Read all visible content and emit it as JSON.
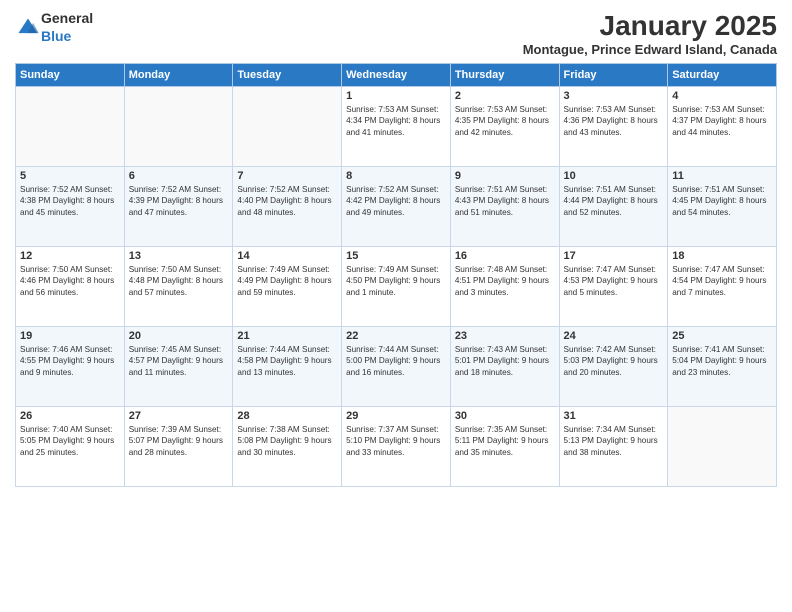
{
  "logo": {
    "general": "General",
    "blue": "Blue"
  },
  "title": "January 2025",
  "location": "Montague, Prince Edward Island, Canada",
  "days_of_week": [
    "Sunday",
    "Monday",
    "Tuesday",
    "Wednesday",
    "Thursday",
    "Friday",
    "Saturday"
  ],
  "weeks": [
    [
      {
        "day": "",
        "info": ""
      },
      {
        "day": "",
        "info": ""
      },
      {
        "day": "",
        "info": ""
      },
      {
        "day": "1",
        "info": "Sunrise: 7:53 AM\nSunset: 4:34 PM\nDaylight: 8 hours\nand 41 minutes."
      },
      {
        "day": "2",
        "info": "Sunrise: 7:53 AM\nSunset: 4:35 PM\nDaylight: 8 hours\nand 42 minutes."
      },
      {
        "day": "3",
        "info": "Sunrise: 7:53 AM\nSunset: 4:36 PM\nDaylight: 8 hours\nand 43 minutes."
      },
      {
        "day": "4",
        "info": "Sunrise: 7:53 AM\nSunset: 4:37 PM\nDaylight: 8 hours\nand 44 minutes."
      }
    ],
    [
      {
        "day": "5",
        "info": "Sunrise: 7:52 AM\nSunset: 4:38 PM\nDaylight: 8 hours\nand 45 minutes."
      },
      {
        "day": "6",
        "info": "Sunrise: 7:52 AM\nSunset: 4:39 PM\nDaylight: 8 hours\nand 47 minutes."
      },
      {
        "day": "7",
        "info": "Sunrise: 7:52 AM\nSunset: 4:40 PM\nDaylight: 8 hours\nand 48 minutes."
      },
      {
        "day": "8",
        "info": "Sunrise: 7:52 AM\nSunset: 4:42 PM\nDaylight: 8 hours\nand 49 minutes."
      },
      {
        "day": "9",
        "info": "Sunrise: 7:51 AM\nSunset: 4:43 PM\nDaylight: 8 hours\nand 51 minutes."
      },
      {
        "day": "10",
        "info": "Sunrise: 7:51 AM\nSunset: 4:44 PM\nDaylight: 8 hours\nand 52 minutes."
      },
      {
        "day": "11",
        "info": "Sunrise: 7:51 AM\nSunset: 4:45 PM\nDaylight: 8 hours\nand 54 minutes."
      }
    ],
    [
      {
        "day": "12",
        "info": "Sunrise: 7:50 AM\nSunset: 4:46 PM\nDaylight: 8 hours\nand 56 minutes."
      },
      {
        "day": "13",
        "info": "Sunrise: 7:50 AM\nSunset: 4:48 PM\nDaylight: 8 hours\nand 57 minutes."
      },
      {
        "day": "14",
        "info": "Sunrise: 7:49 AM\nSunset: 4:49 PM\nDaylight: 8 hours\nand 59 minutes."
      },
      {
        "day": "15",
        "info": "Sunrise: 7:49 AM\nSunset: 4:50 PM\nDaylight: 9 hours\nand 1 minute."
      },
      {
        "day": "16",
        "info": "Sunrise: 7:48 AM\nSunset: 4:51 PM\nDaylight: 9 hours\nand 3 minutes."
      },
      {
        "day": "17",
        "info": "Sunrise: 7:47 AM\nSunset: 4:53 PM\nDaylight: 9 hours\nand 5 minutes."
      },
      {
        "day": "18",
        "info": "Sunrise: 7:47 AM\nSunset: 4:54 PM\nDaylight: 9 hours\nand 7 minutes."
      }
    ],
    [
      {
        "day": "19",
        "info": "Sunrise: 7:46 AM\nSunset: 4:55 PM\nDaylight: 9 hours\nand 9 minutes."
      },
      {
        "day": "20",
        "info": "Sunrise: 7:45 AM\nSunset: 4:57 PM\nDaylight: 9 hours\nand 11 minutes."
      },
      {
        "day": "21",
        "info": "Sunrise: 7:44 AM\nSunset: 4:58 PM\nDaylight: 9 hours\nand 13 minutes."
      },
      {
        "day": "22",
        "info": "Sunrise: 7:44 AM\nSunset: 5:00 PM\nDaylight: 9 hours\nand 16 minutes."
      },
      {
        "day": "23",
        "info": "Sunrise: 7:43 AM\nSunset: 5:01 PM\nDaylight: 9 hours\nand 18 minutes."
      },
      {
        "day": "24",
        "info": "Sunrise: 7:42 AM\nSunset: 5:03 PM\nDaylight: 9 hours\nand 20 minutes."
      },
      {
        "day": "25",
        "info": "Sunrise: 7:41 AM\nSunset: 5:04 PM\nDaylight: 9 hours\nand 23 minutes."
      }
    ],
    [
      {
        "day": "26",
        "info": "Sunrise: 7:40 AM\nSunset: 5:05 PM\nDaylight: 9 hours\nand 25 minutes."
      },
      {
        "day": "27",
        "info": "Sunrise: 7:39 AM\nSunset: 5:07 PM\nDaylight: 9 hours\nand 28 minutes."
      },
      {
        "day": "28",
        "info": "Sunrise: 7:38 AM\nSunset: 5:08 PM\nDaylight: 9 hours\nand 30 minutes."
      },
      {
        "day": "29",
        "info": "Sunrise: 7:37 AM\nSunset: 5:10 PM\nDaylight: 9 hours\nand 33 minutes."
      },
      {
        "day": "30",
        "info": "Sunrise: 7:35 AM\nSunset: 5:11 PM\nDaylight: 9 hours\nand 35 minutes."
      },
      {
        "day": "31",
        "info": "Sunrise: 7:34 AM\nSunset: 5:13 PM\nDaylight: 9 hours\nand 38 minutes."
      },
      {
        "day": "",
        "info": ""
      }
    ]
  ]
}
